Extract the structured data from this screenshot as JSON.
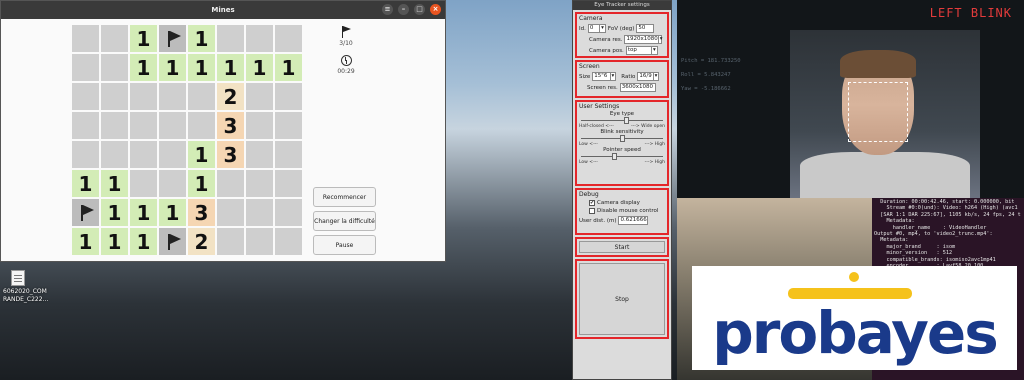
{
  "mines": {
    "title": "Mines",
    "flags": "3/10",
    "time": "00:29",
    "buttons": [
      "Recommencer",
      "Changer la difficulté",
      "Pause"
    ],
    "board": [
      [
        "h",
        "h",
        "1",
        "F",
        "1",
        "h",
        "h",
        "h"
      ],
      [
        "h",
        "h",
        "1",
        "1",
        "1",
        "1",
        "1",
        "1"
      ],
      [
        "h",
        "h",
        "h",
        "h",
        "h",
        "2",
        "h",
        "h"
      ],
      [
        "h",
        "h",
        "h",
        "h",
        "h",
        "3",
        "h",
        "h"
      ],
      [
        "h",
        "h",
        "h",
        "h",
        "1",
        "3",
        "h",
        "h"
      ],
      [
        "1",
        "1",
        "h",
        "h",
        "1",
        "h",
        "h",
        "h"
      ],
      [
        "F",
        "1",
        "1",
        "1",
        "3",
        "h",
        "h",
        "h"
      ],
      [
        "1",
        "1",
        "1",
        "F",
        "2",
        "h",
        "h",
        "h"
      ]
    ]
  },
  "eye_tracker": {
    "title": "Eye Tracker settings",
    "camera": {
      "section": "Camera",
      "id_label": "Id.",
      "id_value": "0",
      "fov_label": "FoV (deg)",
      "fov_value": "50",
      "res_label": "Camera res.",
      "res_value": "1920x1080",
      "pos_label": "Camera pos.",
      "pos_value": "top"
    },
    "screen": {
      "section": "Screen",
      "size_label": "Size",
      "size_value": "15\"6",
      "ratio_label": "Ratio",
      "ratio_value": "16/9",
      "res_label": "Screen res.",
      "res_value": "3600x1080"
    },
    "user": {
      "section": "User Settings",
      "eye_type": "Eye type",
      "eye_left": "Half-closed <---",
      "eye_right": "---> Wide open",
      "eye_level": 0.55,
      "blink": "Blink sensitivity",
      "blink_left": "Low <---",
      "blink_right": "---> High",
      "blink_level": 0.5,
      "pointer": "Pointer speed",
      "pointer_left": "Low <---",
      "pointer_right": "---> High",
      "pointer_level": 0.4
    },
    "debug": {
      "section": "Debug",
      "cam_display": "Camera display",
      "cam_display_checked": "✔",
      "disable_mouse": "Disable mouse control",
      "user_dist_label": "User dist. (m)",
      "user_dist_value": "0.621666"
    },
    "start": "Start",
    "stop": "Stop"
  },
  "video": {
    "left_blink": "LEFT BLINK",
    "pitch": "Pitch = 181.733250",
    "roll": "Roll = 5.843247",
    "yaw": "Yaw = -5.186662"
  },
  "terminal": {
    "lines": [
      "  Duration: 00:00:42.46, start: 0.000000, bit",
      "    Stream #0:0(und): Video: h264 (High) (avc1",
      "  [SAR 1:1 DAR 225:67], 1105 kb/s, 24 fps, 24 t",
      "    Metadata:",
      "      handler_name    : VideoHandler",
      "Output #0, mp4, to 'video2_trunc.mp4':",
      "  Metadata:",
      "    major_brand     : isom",
      "    minor_version   : 512",
      "    compatible_brands: isomiso2avc1mp41",
      "    encoder         : Lavf58.20.100"
    ]
  },
  "desktop_file": {
    "label1": "6062020_COM",
    "label2": "RANDE_C222..."
  },
  "logo": {
    "text": "probayes",
    "dot_color": "#f5c21b",
    "text_color": "#1a3a8a"
  }
}
